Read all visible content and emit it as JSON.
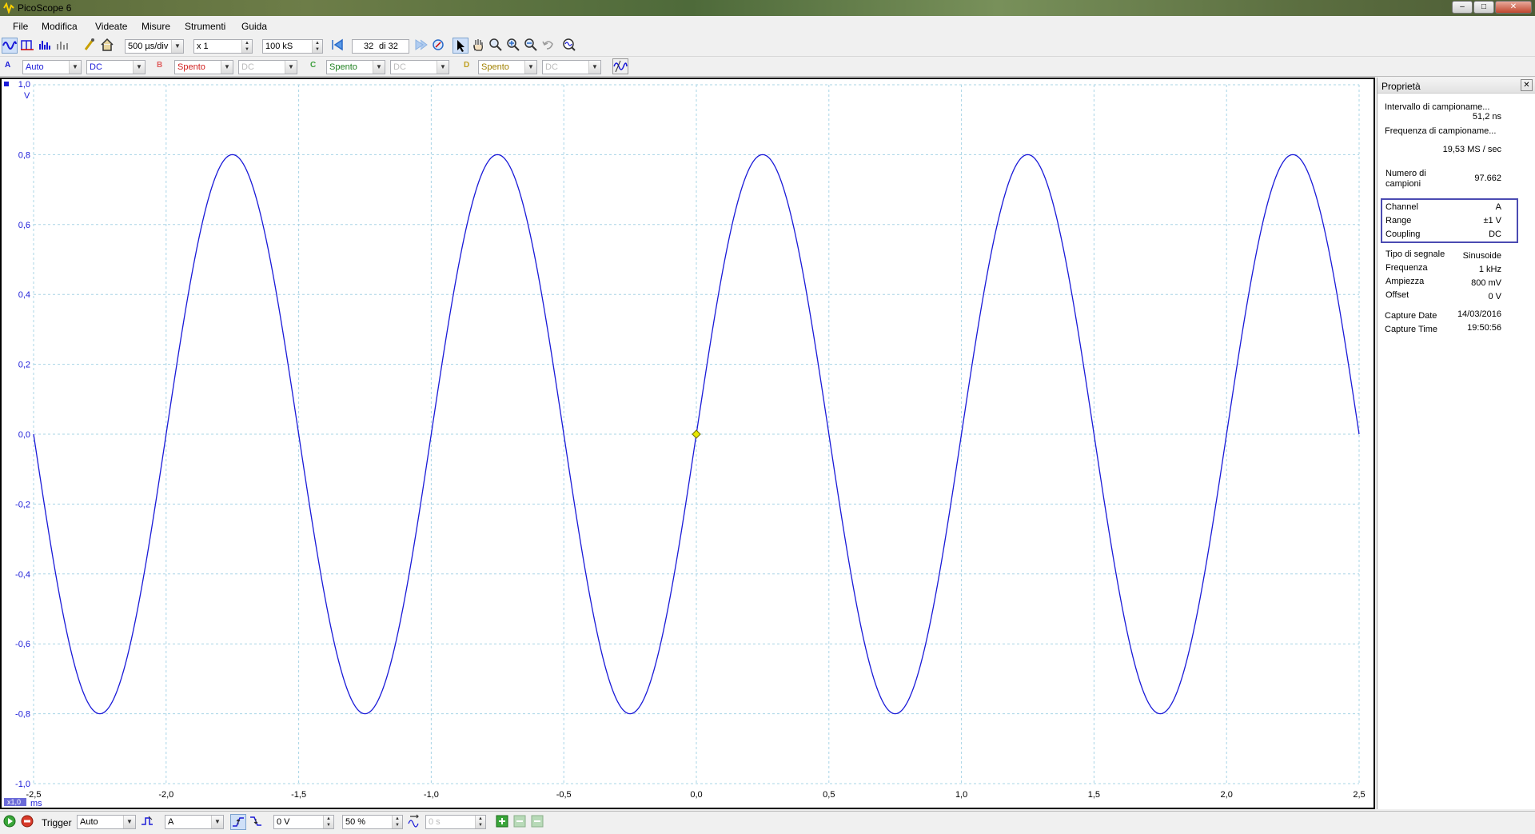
{
  "window": {
    "title": "PicoScope 6",
    "minimize": "–",
    "maximize": "□",
    "close": "✕"
  },
  "menu": [
    "File",
    "Modifica",
    "Videate",
    "Misure",
    "Strumenti",
    "Guida"
  ],
  "toolbar": {
    "timebase": "500 µs/div",
    "zoom": "x 1",
    "samples": "100 kS",
    "buffer_pos": "32",
    "buffer_di": "di 32"
  },
  "channels": {
    "A": {
      "letter": "A",
      "range": "Auto",
      "coupling": "DC"
    },
    "B": {
      "letter": "B",
      "range": "Spento",
      "coupling": "DC"
    },
    "C": {
      "letter": "C",
      "range": "Spento",
      "coupling": "DC"
    },
    "D": {
      "letter": "D",
      "range": "Spento",
      "coupling": "DC"
    }
  },
  "scope": {
    "y_unit": "V",
    "y_ticks": [
      "1,0",
      "0,8",
      "0,6",
      "0,4",
      "0,2",
      "0,0",
      "-0,2",
      "-0,4",
      "-0,6",
      "-0,8",
      "-1,0"
    ],
    "x_ticks": [
      "-2,5",
      "-2,0",
      "-1,5",
      "-1,0",
      "-0,5",
      "0,0",
      "0,5",
      "1,0",
      "1,5",
      "2,0",
      "2,5"
    ],
    "x_unit": "ms",
    "zoom_badge": "x1,0",
    "trace_color": "#1a1ad8",
    "grid_color": "#a8d4e6"
  },
  "chart_data": {
    "type": "line",
    "xlabel": "ms",
    "ylabel": "V",
    "xlim": [
      -2.5,
      2.5
    ],
    "ylim": [
      -1.0,
      1.0
    ],
    "series": [
      {
        "name": "A",
        "function": "sine",
        "amplitude": 0.8,
        "frequency_khz": 1,
        "phase_at_zero": 0,
        "x": [
          -2.5,
          -2.25,
          -2.0,
          -1.75,
          -1.5,
          -1.25,
          -1.0,
          -0.75,
          -0.5,
          -0.25,
          0.0,
          0.25,
          0.5,
          0.75,
          1.0,
          1.25,
          1.5,
          1.75,
          2.0,
          2.25,
          2.5
        ],
        "y": [
          0.0,
          -0.8,
          0.0,
          0.8,
          0.0,
          -0.8,
          0.0,
          0.8,
          0.0,
          -0.8,
          0.0,
          0.8,
          0.0,
          -0.8,
          0.0,
          0.8,
          0.0,
          -0.8,
          0.0,
          0.8,
          0.0
        ]
      }
    ],
    "grid": true
  },
  "properties": {
    "title": "Proprietà",
    "intervallo_label": "Intervallo di campioname...",
    "intervallo_value": "51,2 ns",
    "frequenza_camp_label": "Frequenza di campioname...",
    "frequenza_camp_value": "19,53 MS / sec",
    "numero_label_1": "Numero di",
    "numero_label_2": "campioni",
    "numero_value": "97.662",
    "channel_label": "Channel",
    "channel_value": "A",
    "range_label": "Range",
    "range_value": "±1 V",
    "coupling_label": "Coupling",
    "coupling_value": "DC",
    "tipo_label": "Tipo di segnale",
    "tipo_value": "Sinusoide",
    "freq_label": "Frequenza",
    "freq_value": "1 kHz",
    "ampiezza_label": "Ampiezza",
    "ampiezza_value": "800 mV",
    "offset_label": "Offset",
    "offset_value": "0 V",
    "date_label": "Capture Date",
    "date_value": "14/03/2016",
    "time_label": "Capture Time",
    "time_value": "19:50:56"
  },
  "statusbar": {
    "trigger_label": "Trigger",
    "trigger_mode": "Auto",
    "trigger_source": "A",
    "trigger_level": "0 V",
    "pretrigger": "50 %",
    "delay": "0 s"
  }
}
